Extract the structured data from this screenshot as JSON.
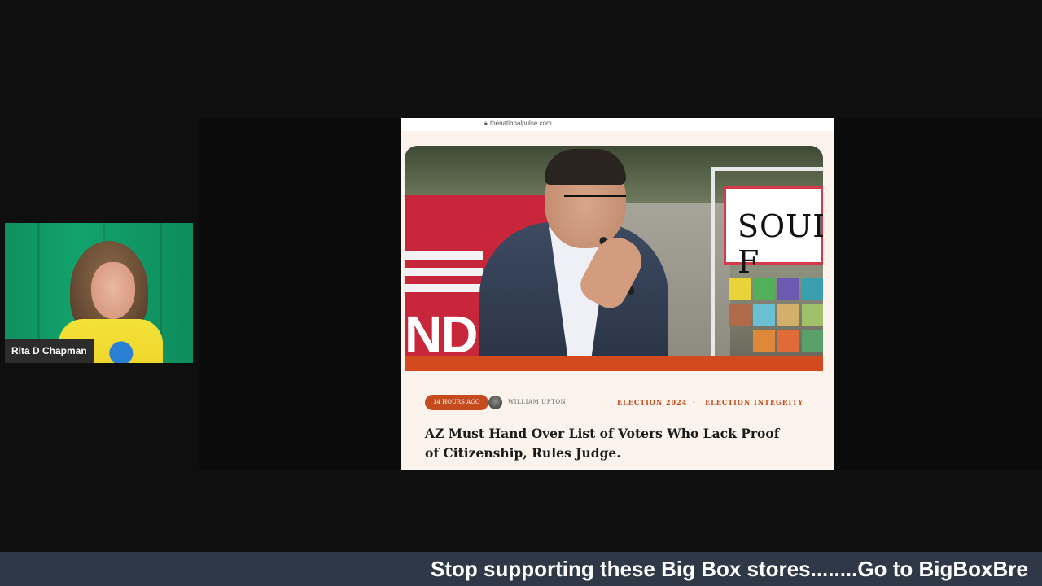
{
  "presenter": {
    "name": "Rita D Chapman"
  },
  "shared_screen": {
    "browser": {
      "url": "thenationalpulse.com",
      "lock_icon": "lock-icon"
    },
    "article": {
      "hero_sign_text": "SOUL F",
      "hero_banner_text": "ND",
      "time_ago": "14 HOURS AGO",
      "author": "WILLIAM UPTON",
      "tags": [
        "ELECTION 2024",
        "ELECTION INTEGRITY"
      ],
      "tag_separator": "•",
      "headline": "AZ Must Hand Over List of Voters Who Lack Proof of Citizenship, Rules Judge."
    }
  },
  "ticker": {
    "text": "Stop supporting these Big Box stores........Go to BigBoxBre"
  },
  "colors": {
    "background": "#0f0f0f",
    "ticker_bg": "#2e3847",
    "accent_orange": "#c54a1c",
    "article_bg": "#fbf3ec"
  }
}
